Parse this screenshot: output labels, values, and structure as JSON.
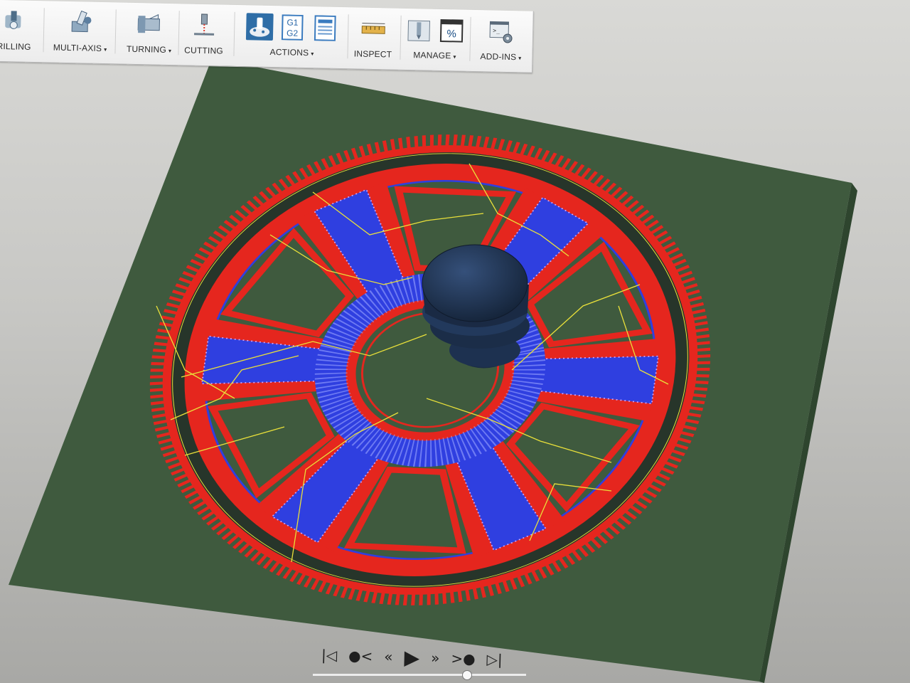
{
  "toolbar": {
    "groups": [
      {
        "label": "RILLING",
        "dropdown": false
      },
      {
        "label": "MULTI-AXIS",
        "dropdown": true
      },
      {
        "label": "TURNING",
        "dropdown": true
      },
      {
        "label": "CUTTING",
        "dropdown": false
      },
      {
        "label": "ACTIONS",
        "dropdown": true
      },
      {
        "label": "INSPECT",
        "dropdown": false
      },
      {
        "label": "MANAGE",
        "dropdown": true
      },
      {
        "label": "ADD-INS",
        "dropdown": true
      }
    ],
    "icons": {
      "drilling": "drill-icon",
      "multi_axis": "multi-axis-icon",
      "turning": "turning-icon",
      "cutting": "waterjet-cutting-icon",
      "simulate": "simulate-icon",
      "post_process": "g1-g2-post-process-icon",
      "setup_sheet": "setup-sheet-icon",
      "inspect": "measure-ruler-icon",
      "tool_library": "tool-library-icon",
      "templates": "percent-template-icon",
      "scripts": "scripts-addin-icon"
    },
    "post_text_1": "G1",
    "post_text_2": "G2",
    "percent_text": "%",
    "caret": "▾"
  },
  "viewport": {
    "stock_color": "#3f5a3e",
    "toolpath_red": "#e5261e",
    "toolpath_blue": "#2f3fe0",
    "rapid_yellow": "#e9e03a",
    "tool_color": "#1e3350",
    "icons": [
      "gear-part",
      "cutting-tool"
    ]
  },
  "playback": {
    "buttons": [
      {
        "name": "go-to-start-button",
        "glyph": "|◁"
      },
      {
        "name": "previous-operation-button",
        "glyph": "●<"
      },
      {
        "name": "step-back-button",
        "glyph": "«"
      },
      {
        "name": "play-button",
        "glyph": "▶"
      },
      {
        "name": "step-forward-button",
        "glyph": "»"
      },
      {
        "name": "next-operation-button",
        "glyph": ">●"
      },
      {
        "name": "go-to-end-button",
        "glyph": "▷|"
      }
    ],
    "progress": 0.7
  }
}
